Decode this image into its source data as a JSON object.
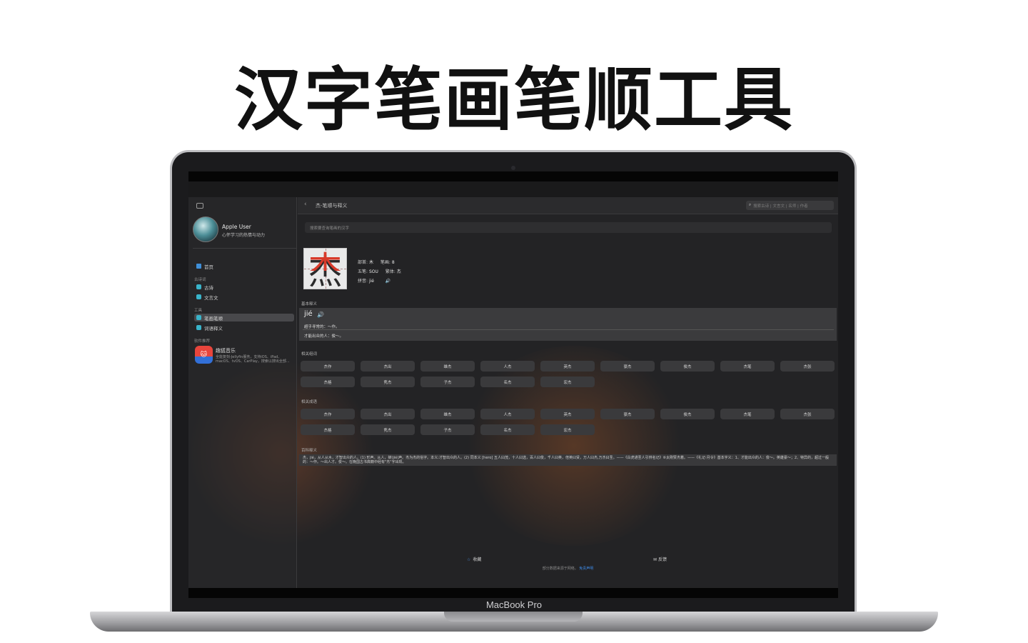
{
  "headline": "汉字笔画笔顺工具",
  "device_label": "MacBook Pro",
  "sidebar": {
    "user_name": "Apple User",
    "user_subtitle": "心怀学习的热情与动力",
    "home_label": "首页",
    "section_poetry": "古诗词",
    "poetry_label": "古诗",
    "classical_label": "文言文",
    "section_tools": "工具",
    "stroke_label": "笔画笔顺",
    "ci_label": "词语释义",
    "section_recommend": "软件推荐",
    "app_name": "趣狐音乐",
    "app_description": "全能复刻-Jellyfin服务，支持iOS、iPad、macOS、tvOS、CarPlay，搜索以搜出全部..."
  },
  "main": {
    "page_title": "杰-笔顺与释义",
    "search_placeholder": "搜索古诗 | 文言文 | 名师 | 作者",
    "char_input_placeholder": "搜索要查询笔画的汉字",
    "character": "杰",
    "radical_label": "部首:",
    "radical": "木",
    "strokes_label": "笔画:",
    "strokes": "8",
    "wubi_label": "五笔:",
    "wubi": "SOU",
    "traditional_label": "繁体:",
    "traditional": "杰",
    "pinyin_label": "拼音:",
    "pinyin": "jié",
    "basic_def_title": "基本释义",
    "def_pinyin": "jié",
    "def_line1": "超乎寻常的：～作。",
    "def_line2": "才能出众的人：俊～。",
    "related_words_title": "相关组词",
    "related_idioms_title": "相关成语",
    "related_words": [
      "杰作",
      "杰出",
      "雄杰",
      "人杰",
      "英杰",
      "豪杰",
      "俊杰",
      "杰笔",
      "杰张",
      "杰格",
      "隽杰",
      "子杰",
      "名杰",
      "宏杰"
    ],
    "related_idioms": [
      "杰作",
      "杰出",
      "雄杰",
      "人杰",
      "英杰",
      "豪杰",
      "俊杰",
      "杰笔",
      "杰张",
      "杰格",
      "隽杰",
      "子杰",
      "名杰",
      "宏杰"
    ],
    "baike_title": "百科释义",
    "baike_text": "杰，jié，从人从木，才智出众的人。(1) 形声。从人，桀(jié)声。杰为杰的俗字。本义:才智出众的人。(2) 同本义 [hero] 五人曰茂，十人曰选，百人曰俊，千人曰英，倍英曰贤，万人曰杰,万杰曰圣。——《白虎通圣人引辨名记》⑥太刚赞杰着。——《礼记·月令》基本字义：1、才能出众的人：俊～。英雄豪～；2、特异的，超过一般的：～作。～出人才。俊～。在晚国古书典籍中经有\"杰\"字出现。",
    "favorite_label": "收藏",
    "feedback_label": "反馈",
    "footnote_text": "部分数据来源于网络。",
    "footnote_link": "免责声明"
  }
}
